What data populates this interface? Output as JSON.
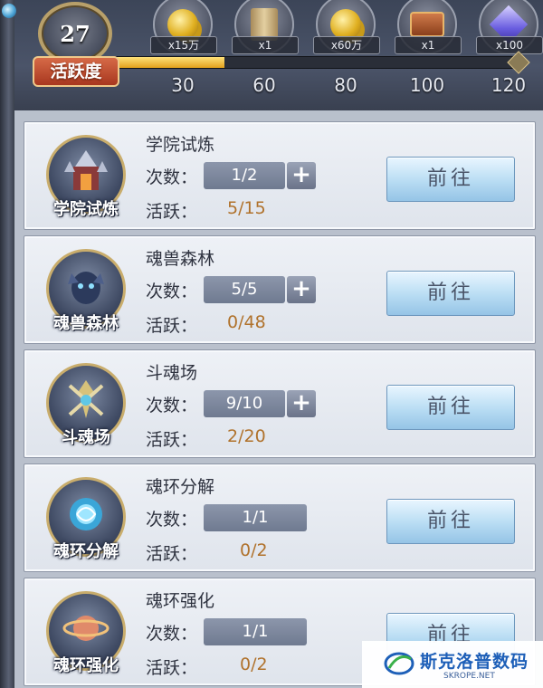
{
  "header": {
    "level": "27",
    "activity_title": "活跃度",
    "progress_value": 32,
    "progress_max": 120,
    "milestones": [
      "30",
      "60",
      "80",
      "100",
      "120"
    ],
    "rewards": [
      {
        "icon": "gold-coins-icon",
        "qty": "x15万"
      },
      {
        "icon": "scroll-icon",
        "qty": "x1"
      },
      {
        "icon": "gold-coins-icon",
        "qty": "x60万"
      },
      {
        "icon": "treasure-chest-icon",
        "qty": "x1"
      },
      {
        "icon": "purple-gem-icon",
        "qty": "x100"
      }
    ]
  },
  "labels": {
    "count": "次数：",
    "activity": "活跃：",
    "go": "前往",
    "plus": "+"
  },
  "tasks": [
    {
      "title": "学院试炼",
      "icon_label": "学院试炼",
      "icon": "academy-trial-icon",
      "count": "1/2",
      "activity": "5/15",
      "has_plus": true
    },
    {
      "title": "魂兽森林",
      "icon_label": "魂兽森林",
      "icon": "soul-beast-forest-icon",
      "count": "5/5",
      "activity": "0/48",
      "has_plus": true
    },
    {
      "title": "斗魂场",
      "icon_label": "斗魂场",
      "icon": "soul-arena-icon",
      "count": "9/10",
      "activity": "2/20",
      "has_plus": true
    },
    {
      "title": "魂环分解",
      "icon_label": "魂环分解",
      "icon": "soul-ring-decompose-icon",
      "count": "1/1",
      "activity": "0/2",
      "has_plus": false
    },
    {
      "title": "魂环强化",
      "icon_label": "魂环强化",
      "icon": "soul-ring-enhance-icon",
      "count": "1/1",
      "activity": "0/2",
      "has_plus": false
    }
  ],
  "watermark": {
    "title": "斯克洛普数码",
    "sub": "SKROPE.NET"
  }
}
